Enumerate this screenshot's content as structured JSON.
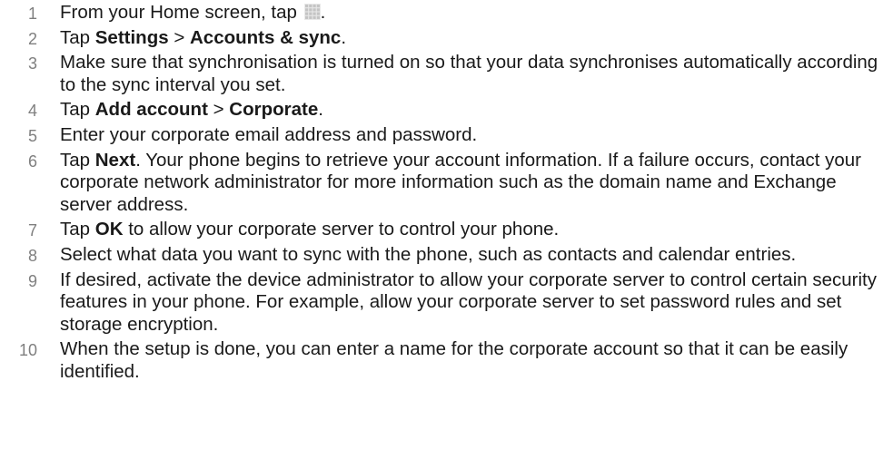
{
  "steps": [
    {
      "num": "1",
      "parts": [
        {
          "t": "From your Home screen, tap "
        },
        {
          "icon": "apps-grid-icon"
        },
        {
          "t": "."
        }
      ]
    },
    {
      "num": "2",
      "parts": [
        {
          "t": "Tap "
        },
        {
          "b": "Settings"
        },
        {
          "t": " > "
        },
        {
          "b": "Accounts & sync"
        },
        {
          "t": "."
        }
      ]
    },
    {
      "num": "3",
      "parts": [
        {
          "t": "Make sure that synchronisation is turned on so that your data synchronises automatically according to the sync interval you set."
        }
      ]
    },
    {
      "num": "4",
      "parts": [
        {
          "t": "Tap "
        },
        {
          "b": "Add account"
        },
        {
          "t": " > "
        },
        {
          "b": "Corporate"
        },
        {
          "t": "."
        }
      ]
    },
    {
      "num": "5",
      "parts": [
        {
          "t": "Enter your corporate email address and password."
        }
      ]
    },
    {
      "num": "6",
      "parts": [
        {
          "t": "Tap "
        },
        {
          "b": "Next"
        },
        {
          "t": ". Your phone begins to retrieve your account information. If a failure occurs, contact your corporate network administrator for more information such as the domain name and Exchange server address."
        }
      ]
    },
    {
      "num": "7",
      "parts": [
        {
          "t": "Tap "
        },
        {
          "b": "OK"
        },
        {
          "t": " to allow your corporate server to control your phone."
        }
      ]
    },
    {
      "num": "8",
      "parts": [
        {
          "t": "Select what data you want to sync with the phone, such as contacts and calendar entries."
        }
      ]
    },
    {
      "num": "9",
      "parts": [
        {
          "t": "If desired, activate the device administrator to allow your corporate server to control certain security features in your phone. For example, allow your corporate server to set password rules and set storage encryption."
        }
      ]
    },
    {
      "num": "10",
      "parts": [
        {
          "t": "When the setup is done, you can enter a name for the corporate account so that it can be easily identified."
        }
      ]
    }
  ],
  "colors": {
    "text": "#1a1a1a",
    "step_number": "#7f7f7f"
  }
}
